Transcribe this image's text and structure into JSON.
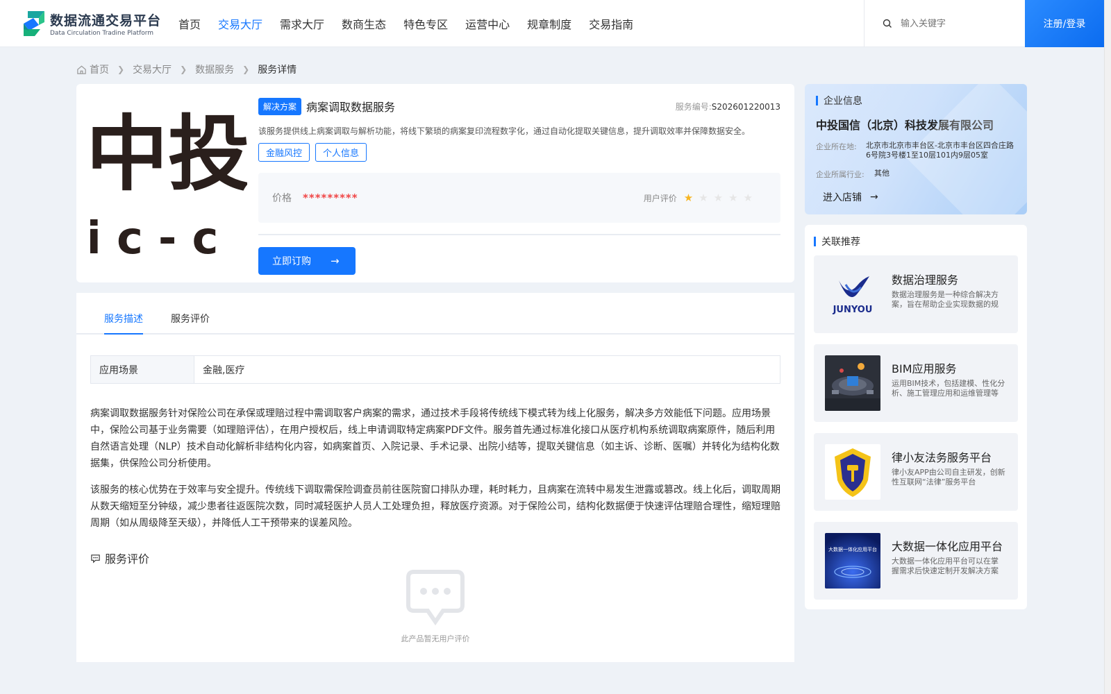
{
  "header": {
    "logo_cn": "数据流通交易平台",
    "logo_en": "Data Circulation Tradine Platform",
    "nav": [
      "首页",
      "交易大厅",
      "需求大厅",
      "数商生态",
      "特色专区",
      "运营中心",
      "规章制度",
      "交易指南"
    ],
    "active_nav": "交易大厅",
    "search_placeholder": "输入关键字",
    "login_label": "注册/登录"
  },
  "breadcrumb": [
    "首页",
    "交易大厅",
    "数据服务",
    "服务详情"
  ],
  "product": {
    "image_text_top": "中投",
    "image_text_bottom": "ic-c",
    "type_badge": "解决方案",
    "title": "病案调取数据服务",
    "service_no_label": "服务编号:",
    "service_no": "S202601220013",
    "description": "该服务提供线上病案调取与解析功能，将线下繁琐的病案复印流程数字化，通过自动化提取关键信息，提升调取效率并保障数据安全。",
    "tags": [
      "金融风控",
      "个人信息"
    ],
    "price_label": "价格",
    "price_value": "*********",
    "rating_label": "用户评价",
    "rating": 1,
    "rating_max": 5,
    "order_label": "立即订购"
  },
  "tabs": [
    "服务描述",
    "服务评价"
  ],
  "active_tab": "服务描述",
  "scene": {
    "label": "应用场景",
    "value": "金融,医疗"
  },
  "paragraphs": [
    "病案调取数据服务针对保险公司在承保或理赔过程中需调取客户病案的需求，通过技术手段将传统线下模式转为线上化服务，解决多方效能低下问题。应用场景中，保险公司基于业务需要（如理赔评估），在用户授权后，线上申请调取特定病案PDF文件。服务首先通过标准化接口从医疗机构系统调取病案原件，随后利用自然语言处理（NLP）技术自动化解析非结构化内容，如病案首页、入院记录、手术记录、出院小结等，提取关键信息（如主诉、诊断、医嘱）并转化为结构化数据集，供保险公司分析使用。",
    "该服务的核心优势在于效率与安全提升。传统线下调取需保险调查员前往医院窗口排队办理，耗时耗力，且病案在流转中易发生泄露或篡改。线上化后，调取周期从数天缩短至分钟级，减少患者往返医院次数，同时减轻医护人员人工处理负担，释放医疗资源。对于保险公司，结构化数据便于快速评估理赔合理性，缩短理赔周期（如从周级降至天级），并降低人工干预带来的误差风险。"
  ],
  "review": {
    "title": "服务评价",
    "empty_text": "此产品暂无用户评价"
  },
  "company": {
    "section_title": "企业信息",
    "name": "中投国信（北京）科技发展有限公司",
    "address_label": "企业所在地:",
    "address": "北京市北京市丰台区-北京市丰台区四合庄路6号院3号楼1至10层101内9层05室",
    "industry_label": "企业所属行业:",
    "industry": "其他",
    "enter_shop": "进入店铺"
  },
  "recommend": {
    "section_title": "关联推荐",
    "items": [
      {
        "title": "数据治理服务",
        "desc": "数据治理服务是一种综合解决方案，旨在帮助企业实现数据的规范化管理",
        "thumb_text": "JUNYOU"
      },
      {
        "title": "BIM应用服务",
        "desc": "运用BIM技术，包括建模、性化分析、施工管理应用和运维管理等服务",
        "thumb_text": ""
      },
      {
        "title": "律小友法务服务平台",
        "desc": "律小友APP由公司自主研发，创新性互联网“法律”服务平台",
        "thumb_text": ""
      },
      {
        "title": "大数据一体化应用平台",
        "desc": "大数据一体化应用平台可以在掌握需求后快速定制开发解决方案",
        "thumb_text": "大数据一体化应用平台"
      }
    ]
  },
  "colors": {
    "primary": "#1677ff",
    "price": "#f04747",
    "star": "#f7b521"
  }
}
